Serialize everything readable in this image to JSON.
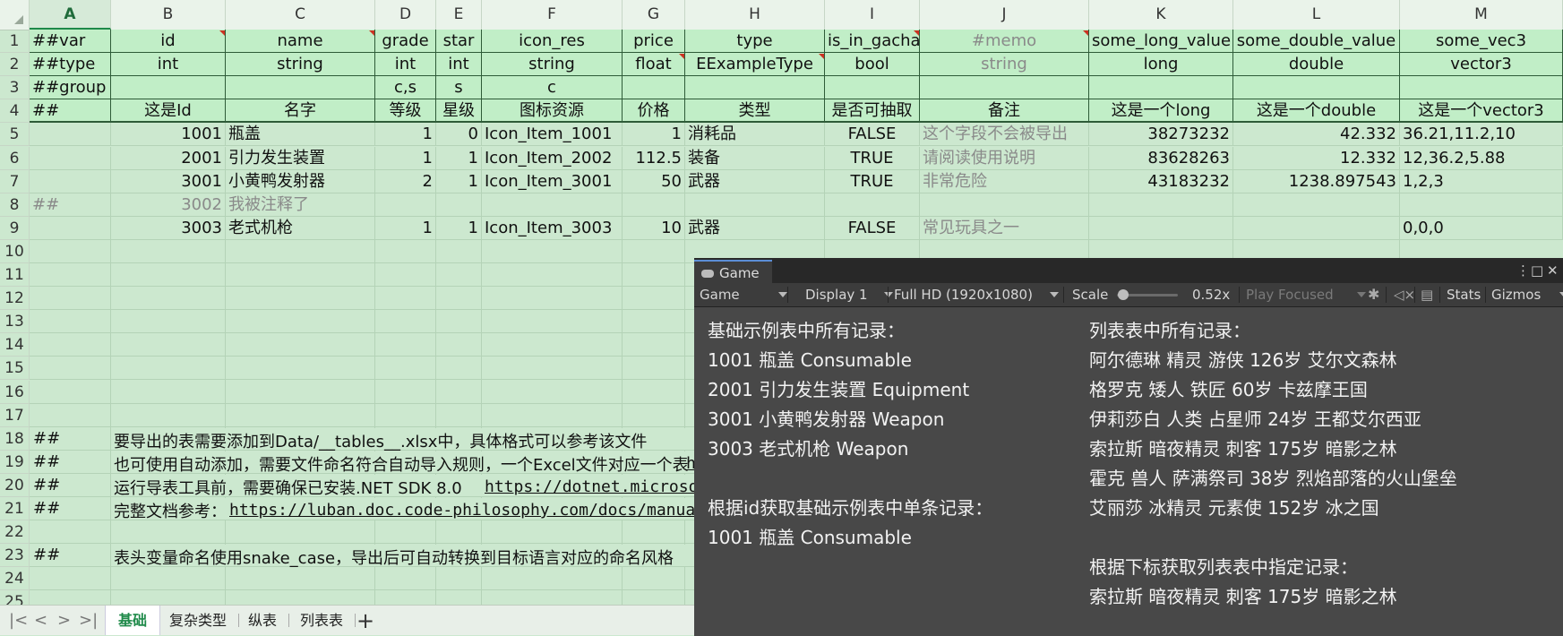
{
  "sheet": {
    "columns": [
      "A",
      "B",
      "C",
      "D",
      "E",
      "F",
      "G",
      "H",
      "I",
      "J",
      "K",
      "L",
      "M"
    ],
    "selected_column": "A",
    "row_numbers": [
      "1",
      "2",
      "3",
      "4",
      "5",
      "6",
      "7",
      "8",
      "9",
      "10",
      "11",
      "12",
      "13",
      "14",
      "15",
      "16",
      "17",
      "18",
      "19",
      "20",
      "21",
      "22",
      "23",
      "24",
      "25"
    ],
    "header_rows": [
      [
        "##var",
        "id",
        "name",
        "grade",
        "star",
        "icon_res",
        "price",
        "type",
        "is_in_gacha",
        "#memo",
        "some_long_value",
        "some_double_value",
        "some_vec3"
      ],
      [
        "##type",
        "int",
        "string",
        "int",
        "int",
        "string",
        "float",
        "EExampleType",
        "bool",
        "string",
        "long",
        "double",
        "vector3"
      ],
      [
        "##group",
        "",
        "",
        "c,s",
        "s",
        "c",
        "",
        "",
        "",
        "",
        "",
        "",
        ""
      ],
      [
        "##",
        "这是Id",
        "名字",
        "等级",
        "星级",
        "图标资源",
        "价格",
        "类型",
        "是否可抽取",
        "备注",
        "这是一个long",
        "这是一个double",
        "这是一个vector3"
      ]
    ],
    "data_rows": [
      [
        "",
        "1001",
        "瓶盖",
        "1",
        "0",
        "Icon_Item_1001",
        "1",
        "消耗品",
        "FALSE",
        "这个字段不会被导出",
        "38273232",
        "42.332",
        "36.21,11.2,10"
      ],
      [
        "",
        "2001",
        "引力发生装置",
        "1",
        "1",
        "Icon_Item_2002",
        "112.5",
        "装备",
        "TRUE",
        "请阅读使用说明",
        "83628263",
        "12.332",
        "12,36.2,5.88"
      ],
      [
        "",
        "3001",
        "小黄鸭发射器",
        "2",
        "1",
        "Icon_Item_3001",
        "50",
        "武器",
        "TRUE",
        "非常危险",
        "43183232",
        "1238.897543",
        "1,2,3"
      ],
      [
        "##",
        "3002",
        "我被注释了",
        "",
        "",
        "",
        "",
        "",
        "",
        "",
        "",
        "",
        ""
      ],
      [
        "",
        "3003",
        "老式机枪",
        "1",
        "1",
        "Icon_Item_3003",
        "10",
        "武器",
        "FALSE",
        "常见玩具之一",
        "",
        "",
        "0,0,0"
      ]
    ],
    "notes": {
      "r18": {
        "a": "##",
        "text": "要导出的表需要添加到Data/__tables__.xlsx中，具体格式可以参考该文件"
      },
      "r19": {
        "a": "##",
        "text": "也可使用自动添加，需要文件命名符合自动导入规则，一个Excel文件对应一个表",
        "link_fragment": "h"
      },
      "r20": {
        "a": "##",
        "text": "运行导表工具前，需要确保已安装.NET SDK 8.0",
        "link": "https://dotnet.microsoft.co"
      },
      "r21": {
        "a": "##",
        "text": "完整文档参考：",
        "link": "https://luban.doc.code-philosophy.com/docs/manual/excel"
      },
      "r23": {
        "a": "##",
        "text": "表头变量命名使用snake_case，导出后可自动转换到目标语言对应的命名风格"
      }
    },
    "tabs": [
      "基础",
      "复杂类型",
      "纵表",
      "列表表"
    ],
    "active_tab": "基础",
    "add_tab": "+"
  },
  "game": {
    "tab_title": "Game",
    "toolbar": {
      "mode": "Game",
      "display": "Display 1",
      "resolution": "Full HD (1920x1080)",
      "scale_label": "Scale",
      "scale_value": "0.52x",
      "scale_fraction": 0.05,
      "play_focused": "Play Focused",
      "stats": "Stats",
      "gizmos": "Gizmos"
    },
    "left_lines": [
      "基础示例表中所有记录：",
      "1001 瓶盖 Consumable",
      "2001 引力发生装置 Equipment",
      "3001 小黄鸭发射器 Weapon",
      "3003 老式机枪 Weapon",
      "",
      "根据id获取基础示例表中单条记录：",
      "1001 瓶盖 Consumable"
    ],
    "right_lines": [
      "列表表中所有记录：",
      "阿尔德琳 精灵 游侠 126岁 艾尔文森林",
      "格罗克 矮人 铁匠 60岁 卡兹摩王国",
      "伊莉莎白 人类 占星师 24岁 王都艾尔西亚",
      "索拉斯 暗夜精灵 刺客 175岁 暗影之林",
      "霍克 兽人 萨满祭司 38岁 烈焰部落的火山堡垒",
      "艾丽莎 冰精灵 元素使 152岁 冰之国",
      "",
      "根据下标获取列表表中指定记录：",
      "索拉斯 暗夜精灵 刺客 175岁 暗影之林"
    ]
  }
}
